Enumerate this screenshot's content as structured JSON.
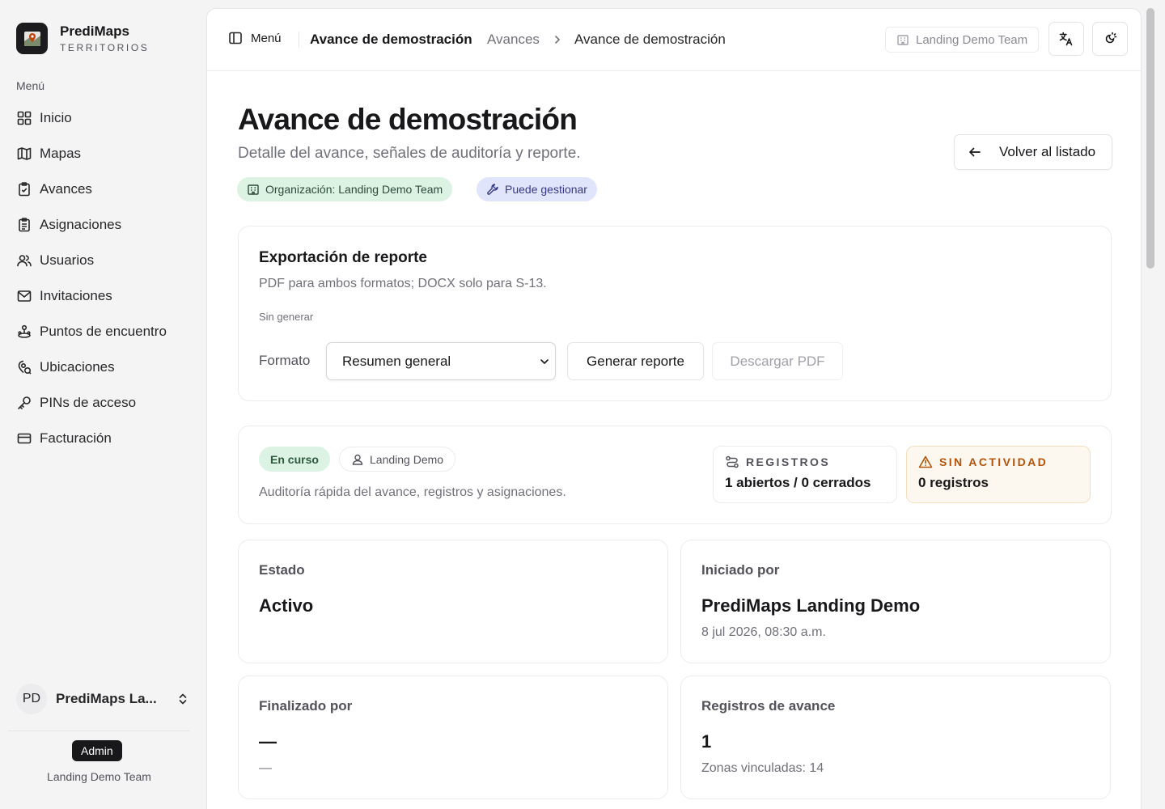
{
  "brand": {
    "name": "PrediMaps",
    "subtitle": "TERRITORIOS"
  },
  "sidebar": {
    "section_label": "Menú",
    "items": [
      {
        "label": "Inicio",
        "icon": "grid-icon"
      },
      {
        "label": "Mapas",
        "icon": "map-icon"
      },
      {
        "label": "Avances",
        "icon": "clipboard-check-icon"
      },
      {
        "label": "Asignaciones",
        "icon": "clipboard-list-icon"
      },
      {
        "label": "Usuarios",
        "icon": "users-icon"
      },
      {
        "label": "Invitaciones",
        "icon": "mail-icon"
      },
      {
        "label": "Puntos de encuentro",
        "icon": "meeting-point-icon"
      },
      {
        "label": "Ubicaciones",
        "icon": "location-icon"
      },
      {
        "label": "PINs de acceso",
        "icon": "key-icon"
      },
      {
        "label": "Facturación",
        "icon": "credit-card-icon"
      }
    ],
    "user": {
      "initials": "PD",
      "name": "PrediMaps La..."
    },
    "role": "Admin",
    "team": "Landing Demo Team"
  },
  "topbar": {
    "menu_label": "Menú",
    "title": "Avance de demostración",
    "breadcrumb": {
      "parent": "Avances",
      "current": "Avance de demostración"
    },
    "team": "Landing Demo Team"
  },
  "page": {
    "title": "Avance de demostración",
    "subtitle": "Detalle del avance, señales de auditoría y reporte.",
    "back_label": "Volver al listado",
    "tags": {
      "organization": "Organización: Landing Demo Team",
      "permission": "Puede gestionar"
    }
  },
  "export": {
    "title": "Exportación de reporte",
    "description": "PDF para ambos formatos; DOCX solo para S-13.",
    "status": "Sin generar",
    "format_label": "Formato",
    "format_value": "Resumen general",
    "generate_label": "Generar reporte",
    "download_label": "Descargar PDF"
  },
  "audit": {
    "status_chip": "En curso",
    "owner_chip": "Landing Demo",
    "description": "Auditoría rápida del avance, registros y asignaciones.",
    "registros": {
      "label": "REGISTROS",
      "value": "1 abiertos / 0 cerrados"
    },
    "warning": {
      "label": "SIN ACTIVIDAD",
      "value": "0 registros"
    }
  },
  "info": {
    "estado": {
      "label": "Estado",
      "value": "Activo"
    },
    "iniciado": {
      "label": "Iniciado por",
      "value": "PrediMaps Landing Demo",
      "sub": "8 jul 2026, 08:30 a.m."
    },
    "finalizado": {
      "label": "Finalizado por",
      "value": "—",
      "sub": "—"
    },
    "registros": {
      "label": "Registros de avance",
      "value": "1",
      "sub": "Zonas vinculadas: 14"
    }
  },
  "colors": {
    "accent_green_bg": "#dcf3e4",
    "accent_blue_bg": "#e1e5fb",
    "warning": "#b45309",
    "warning_bg": "#fdf8ef",
    "ink": "#18181b"
  }
}
